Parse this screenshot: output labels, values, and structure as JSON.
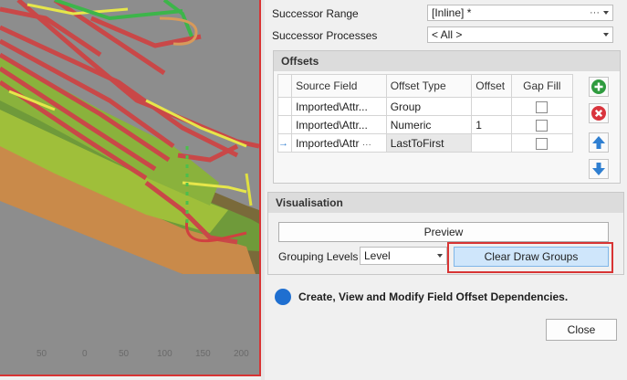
{
  "viewport": {
    "axis_labels": [
      "50",
      "0",
      "50",
      "100",
      "150",
      "200"
    ]
  },
  "successor_range": {
    "label": "Successor Range",
    "value": "[Inline] *"
  },
  "successor_processes": {
    "label": "Successor Processes",
    "value": "< All >"
  },
  "offsets": {
    "title": "Offsets",
    "columns": [
      "Source Field",
      "Offset Type",
      "Offset",
      "Gap Fill"
    ],
    "rows": [
      {
        "source": "Imported\\Attr...",
        "type": "Group",
        "offset": "",
        "gap_fill": false
      },
      {
        "source": "Imported\\Attr...",
        "type": "Numeric",
        "offset": "1",
        "gap_fill": false
      },
      {
        "source": "Imported\\Attr",
        "type": "LastToFirst",
        "offset": "",
        "gap_fill": false
      }
    ],
    "current_row_marker": "→",
    "row_ellipsis": "···",
    "side_icons": [
      "add-icon",
      "remove-icon",
      "move-up-icon",
      "move-down-icon"
    ]
  },
  "visualisation": {
    "title": "Visualisation",
    "preview_label": "Preview",
    "grouping_label": "Grouping Levels",
    "grouping_value": "Level",
    "clear_label": "Clear Draw Groups"
  },
  "info": {
    "text": "Create, View and Modify Field Offset Dependencies."
  },
  "close_label": "Close",
  "colors": {
    "highlight_red": "#d83434",
    "info_blue": "#1f6fd0",
    "add_green": "#2e9b3e",
    "remove_red": "#d9343d",
    "arrow_blue": "#2f7fd1"
  }
}
